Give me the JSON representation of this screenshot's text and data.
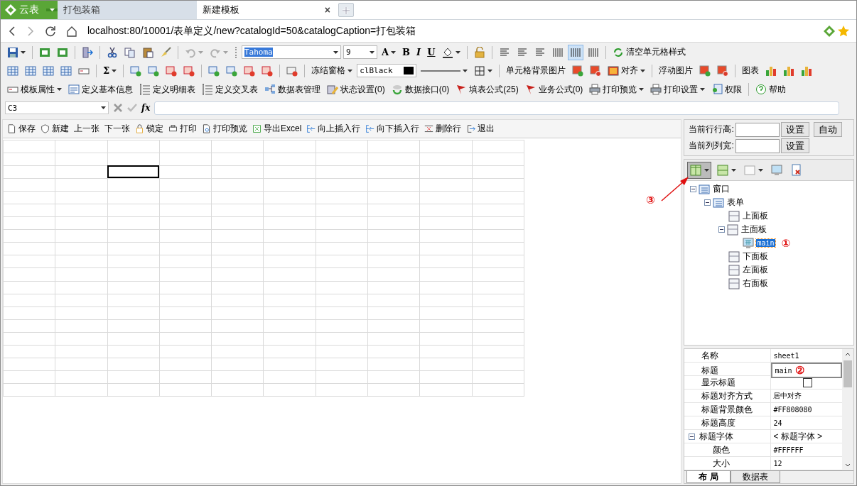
{
  "browser": {
    "brand": {
      "label": "云表",
      "dropdown": true
    },
    "tabs": [
      {
        "label": "打包装箱",
        "selected": false
      },
      {
        "label": "新建模板",
        "selected": true,
        "close": "×"
      }
    ],
    "address": "localhost:80/10001/表单定义/new?catalogId=50&catalogCaption=打包装箱"
  },
  "toolbars": [
    [
      {
        "kind": "icon",
        "dropdown": true
      },
      {
        "kind": "sep"
      },
      {
        "kind": "icon",
        "dropdown": false
      },
      {
        "kind": "icon",
        "dropdown": false
      },
      {
        "kind": "sep"
      },
      {
        "kind": "icon",
        "dropdown": false
      },
      {
        "kind": "sep"
      },
      {
        "kind": "icon",
        "dropdown": false
      },
      {
        "kind": "icon",
        "dropdown": false
      },
      {
        "kind": "icon",
        "dropdown": false
      },
      {
        "kind": "icon",
        "dropdown": false
      },
      {
        "kind": "sep"
      },
      {
        "kind": "icon",
        "dropdown": true,
        "disabled": true
      },
      {
        "kind": "icon",
        "dropdown": true,
        "disabled": true
      },
      {
        "kind": "grip"
      },
      {
        "kind": "combo",
        "value": "Tahoma",
        "highlighted": true,
        "wide": true
      },
      {
        "kind": "combo",
        "value": "9",
        "highlighted": false,
        "wide": false
      },
      {
        "kind": "glyph",
        "label": "A",
        "dropdown": true
      },
      {
        "kind": "glyph",
        "label": "B",
        "dropdown": false
      },
      {
        "kind": "glyph",
        "label": "I",
        "dropdown": false
      },
      {
        "kind": "glyph",
        "label": "U",
        "dropdown": false
      },
      {
        "kind": "icon",
        "dropdown": true
      },
      {
        "kind": "sep"
      },
      {
        "kind": "icon",
        "dropdown": false
      },
      {
        "kind": "sep"
      },
      {
        "kind": "icon",
        "dropdown": false
      },
      {
        "kind": "icon",
        "dropdown": false
      },
      {
        "kind": "icon",
        "dropdown": false
      },
      {
        "kind": "icon",
        "dropdown": false,
        "pressed": false
      },
      {
        "kind": "icon",
        "dropdown": false,
        "pressed": true
      },
      {
        "kind": "icon",
        "dropdown": false,
        "pressed": false
      },
      {
        "kind": "sep"
      },
      {
        "kind": "icon-text",
        "label": "清空单元格样式",
        "dropdown": false
      }
    ],
    [
      {
        "kind": "icon",
        "dropdown": false
      },
      {
        "kind": "icon",
        "dropdown": false
      },
      {
        "kind": "icon",
        "dropdown": false
      },
      {
        "kind": "icon",
        "dropdown": false
      },
      {
        "kind": "icon",
        "dropdown": false
      },
      {
        "kind": "sep"
      },
      {
        "kind": "glyph",
        "label": "Σ",
        "dropdown": true
      },
      {
        "kind": "sep"
      },
      {
        "kind": "icon",
        "dropdown": false
      },
      {
        "kind": "icon",
        "dropdown": false
      },
      {
        "kind": "icon",
        "dropdown": false
      },
      {
        "kind": "icon",
        "dropdown": false
      },
      {
        "kind": "sep"
      },
      {
        "kind": "icon",
        "dropdown": false
      },
      {
        "kind": "icon",
        "dropdown": false
      },
      {
        "kind": "icon",
        "dropdown": false
      },
      {
        "kind": "icon",
        "dropdown": false
      },
      {
        "kind": "sep"
      },
      {
        "kind": "icon",
        "dropdown": false
      },
      {
        "kind": "sep"
      },
      {
        "kind": "text",
        "label": "冻结窗格",
        "dropdown": true
      },
      {
        "kind": "color-combo",
        "value": "clBlack",
        "color": "#000000"
      },
      {
        "kind": "line",
        "dropdown": true
      },
      {
        "kind": "icon",
        "dropdown": true
      },
      {
        "kind": "sep"
      },
      {
        "kind": "text",
        "label": "单元格背景图片",
        "dropdown": false
      },
      {
        "kind": "icon",
        "dropdown": false
      },
      {
        "kind": "icon",
        "dropdown": false
      },
      {
        "kind": "icon-text",
        "label": "对齐",
        "dropdown": true
      },
      {
        "kind": "sep"
      },
      {
        "kind": "text",
        "label": "浮动图片",
        "dropdown": false
      },
      {
        "kind": "icon",
        "dropdown": false
      },
      {
        "kind": "icon",
        "dropdown": false
      },
      {
        "kind": "sep"
      },
      {
        "kind": "text",
        "label": "图表",
        "dropdown": false
      },
      {
        "kind": "icon",
        "dropdown": false
      },
      {
        "kind": "icon",
        "dropdown": false
      },
      {
        "kind": "icon",
        "dropdown": false
      }
    ],
    [
      {
        "kind": "icon-text",
        "label": "模板属性",
        "dropdown": true
      },
      {
        "kind": "icon-text",
        "label": "定义基本信息",
        "dropdown": false
      },
      {
        "kind": "icon-text",
        "label": "定义明细表",
        "dropdown": false
      },
      {
        "kind": "icon-text",
        "label": "定义交叉表",
        "dropdown": false
      },
      {
        "kind": "icon-text",
        "label": "数据表管理",
        "dropdown": false
      },
      {
        "kind": "icon-text",
        "label": "状态设置(0)",
        "dropdown": false
      },
      {
        "kind": "icon-text",
        "label": "数据接口(0)",
        "dropdown": false
      },
      {
        "kind": "icon-text",
        "label": "填表公式(25)",
        "dropdown": false
      },
      {
        "kind": "icon-text",
        "label": "业务公式(0)",
        "dropdown": false
      },
      {
        "kind": "icon-text",
        "label": "打印预览",
        "dropdown": true
      },
      {
        "kind": "icon-text",
        "label": "打印设置",
        "dropdown": true
      },
      {
        "kind": "icon-text",
        "label": "权限",
        "dropdown": false
      },
      {
        "kind": "sep"
      },
      {
        "kind": "icon-text",
        "label": "帮助",
        "dropdown": false
      }
    ]
  ],
  "formula_bar": {
    "name_box": "C3",
    "fx": "fx"
  },
  "actions": [
    "保存",
    "新建",
    "上一张",
    "下一张",
    "锁定",
    "打印",
    "打印预览",
    "导出Excel",
    "向上插入行",
    "向下插入行",
    "删除行",
    "退出"
  ],
  "sheet": {
    "rows": [
      [
        {
          "selected": false
        },
        {
          "selected": false
        },
        {
          "selected": false
        },
        {
          "selected": false
        },
        {
          "selected": false
        },
        {
          "selected": false
        },
        {
          "selected": false
        },
        {
          "selected": false
        },
        {
          "selected": false
        },
        {
          "selected": false
        }
      ],
      [
        {
          "selected": false
        },
        {
          "selected": false
        },
        {
          "selected": false
        },
        {
          "selected": false
        },
        {
          "selected": false
        },
        {
          "selected": false
        },
        {
          "selected": false
        },
        {
          "selected": false
        },
        {
          "selected": false
        },
        {
          "selected": false
        }
      ],
      [
        {
          "selected": false
        },
        {
          "selected": false
        },
        {
          "selected": true
        },
        {
          "selected": false
        },
        {
          "selected": false
        },
        {
          "selected": false
        },
        {
          "selected": false
        },
        {
          "selected": false
        },
        {
          "selected": false
        },
        {
          "selected": false
        }
      ],
      [
        {
          "selected": false
        },
        {
          "selected": false
        },
        {
          "selected": false
        },
        {
          "selected": false
        },
        {
          "selected": false
        },
        {
          "selected": false
        },
        {
          "selected": false
        },
        {
          "selected": false
        },
        {
          "selected": false
        },
        {
          "selected": false
        }
      ],
      [
        {
          "selected": false
        },
        {
          "selected": false
        },
        {
          "selected": false
        },
        {
          "selected": false
        },
        {
          "selected": false
        },
        {
          "selected": false
        },
        {
          "selected": false
        },
        {
          "selected": false
        },
        {
          "selected": false
        },
        {
          "selected": false
        }
      ],
      [
        {
          "selected": false
        },
        {
          "selected": false
        },
        {
          "selected": false
        },
        {
          "selected": false
        },
        {
          "selected": false
        },
        {
          "selected": false
        },
        {
          "selected": false
        },
        {
          "selected": false
        },
        {
          "selected": false
        },
        {
          "selected": false
        }
      ],
      [
        {
          "selected": false
        },
        {
          "selected": false
        },
        {
          "selected": false
        },
        {
          "selected": false
        },
        {
          "selected": false
        },
        {
          "selected": false
        },
        {
          "selected": false
        },
        {
          "selected": false
        },
        {
          "selected": false
        },
        {
          "selected": false
        }
      ],
      [
        {
          "selected": false
        },
        {
          "selected": false
        },
        {
          "selected": false
        },
        {
          "selected": false
        },
        {
          "selected": false
        },
        {
          "selected": false
        },
        {
          "selected": false
        },
        {
          "selected": false
        },
        {
          "selected": false
        },
        {
          "selected": false
        }
      ],
      [
        {
          "selected": false
        },
        {
          "selected": false
        },
        {
          "selected": false
        },
        {
          "selected": false
        },
        {
          "selected": false
        },
        {
          "selected": false
        },
        {
          "selected": false
        },
        {
          "selected": false
        },
        {
          "selected": false
        },
        {
          "selected": false
        }
      ],
      [
        {
          "selected": false
        },
        {
          "selected": false
        },
        {
          "selected": false
        },
        {
          "selected": false
        },
        {
          "selected": false
        },
        {
          "selected": false
        },
        {
          "selected": false
        },
        {
          "selected": false
        },
        {
          "selected": false
        },
        {
          "selected": false
        }
      ],
      [
        {
          "selected": false
        },
        {
          "selected": false
        },
        {
          "selected": false
        },
        {
          "selected": false
        },
        {
          "selected": false
        },
        {
          "selected": false
        },
        {
          "selected": false
        },
        {
          "selected": false
        },
        {
          "selected": false
        },
        {
          "selected": false
        }
      ],
      [
        {
          "selected": false
        },
        {
          "selected": false
        },
        {
          "selected": false
        },
        {
          "selected": false
        },
        {
          "selected": false
        },
        {
          "selected": false
        },
        {
          "selected": false
        },
        {
          "selected": false
        },
        {
          "selected": false
        },
        {
          "selected": false
        }
      ],
      [
        {
          "selected": false
        },
        {
          "selected": false
        },
        {
          "selected": false
        },
        {
          "selected": false
        },
        {
          "selected": false
        },
        {
          "selected": false
        },
        {
          "selected": false
        },
        {
          "selected": false
        },
        {
          "selected": false
        },
        {
          "selected": false
        }
      ],
      [
        {
          "selected": false
        },
        {
          "selected": false
        },
        {
          "selected": false
        },
        {
          "selected": false
        },
        {
          "selected": false
        },
        {
          "selected": false
        },
        {
          "selected": false
        },
        {
          "selected": false
        },
        {
          "selected": false
        },
        {
          "selected": false
        }
      ],
      [
        {
          "selected": false
        },
        {
          "selected": false
        },
        {
          "selected": false
        },
        {
          "selected": false
        },
        {
          "selected": false
        },
        {
          "selected": false
        },
        {
          "selected": false
        },
        {
          "selected": false
        },
        {
          "selected": false
        },
        {
          "selected": false
        }
      ],
      [
        {
          "selected": false
        },
        {
          "selected": false
        },
        {
          "selected": false
        },
        {
          "selected": false
        },
        {
          "selected": false
        },
        {
          "selected": false
        },
        {
          "selected": false
        },
        {
          "selected": false
        },
        {
          "selected": false
        },
        {
          "selected": false
        }
      ],
      [
        {
          "selected": false
        },
        {
          "selected": false
        },
        {
          "selected": false
        },
        {
          "selected": false
        },
        {
          "selected": false
        },
        {
          "selected": false
        },
        {
          "selected": false
        },
        {
          "selected": false
        },
        {
          "selected": false
        },
        {
          "selected": false
        }
      ],
      [
        {
          "selected": false
        },
        {
          "selected": false
        },
        {
          "selected": false
        },
        {
          "selected": false
        },
        {
          "selected": false
        },
        {
          "selected": false
        },
        {
          "selected": false
        },
        {
          "selected": false
        },
        {
          "selected": false
        },
        {
          "selected": false
        }
      ],
      [
        {
          "selected": false
        },
        {
          "selected": false
        },
        {
          "selected": false
        },
        {
          "selected": false
        },
        {
          "selected": false
        },
        {
          "selected": false
        },
        {
          "selected": false
        },
        {
          "selected": false
        },
        {
          "selected": false
        },
        {
          "selected": false
        }
      ],
      [
        {
          "selected": false
        },
        {
          "selected": false
        },
        {
          "selected": false
        },
        {
          "selected": false
        },
        {
          "selected": false
        },
        {
          "selected": false
        },
        {
          "selected": false
        },
        {
          "selected": false
        },
        {
          "selected": false
        },
        {
          "selected": false
        }
      ]
    ]
  },
  "size_panel": {
    "row_height_label": "当前行行高:",
    "col_width_label": "当前列列宽:",
    "set_row": "设置",
    "auto": "自动",
    "set_col": "设置"
  },
  "tree_toolbar": [
    {
      "pressed": true,
      "dropdown": true
    },
    {
      "pressed": false,
      "dropdown": true
    },
    {
      "pressed": false,
      "dropdown": true
    },
    {
      "pressed": false,
      "dropdown": false
    },
    {
      "pressed": false,
      "dropdown": false
    }
  ],
  "tree": [
    {
      "label": "窗口",
      "expanded": true,
      "selected": false,
      "children": [
        {
          "label": "表单",
          "expanded": true,
          "selected": false,
          "children": [
            {
              "label": "上面板",
              "selected": false
            },
            {
              "label": "主面板",
              "expanded": true,
              "selected": false,
              "children": [
                {
                  "label": "main",
                  "selected": true,
                  "annotation": "①"
                }
              ]
            },
            {
              "label": "下面板",
              "selected": false
            },
            {
              "label": "左面板",
              "selected": false
            },
            {
              "label": "右面板",
              "selected": false
            }
          ]
        }
      ]
    }
  ],
  "arrow_annotation": "③",
  "properties": [
    {
      "kind": "text",
      "name": "名称",
      "value": "sheet1"
    },
    {
      "kind": "edit",
      "name": "标题",
      "value": "main",
      "annotation": "②"
    },
    {
      "kind": "checkbox",
      "name": "显示标题",
      "checked": false
    },
    {
      "kind": "text",
      "name": "标题对齐方式",
      "value": "居中对齐"
    },
    {
      "kind": "text",
      "name": "标题背景颜色",
      "value": "#FF808080"
    },
    {
      "kind": "text",
      "name": "标题高度",
      "value": "24"
    },
    {
      "kind": "group",
      "name": "标题字体",
      "value": "< 标题字体 >",
      "expanded": true
    },
    {
      "kind": "sub",
      "name": "颜色",
      "value": "#FFFFFF"
    },
    {
      "kind": "sub",
      "name": "大小",
      "value": "12"
    }
  ],
  "bottom_tabs": [
    {
      "label": "布 局",
      "selected": true
    },
    {
      "label": "数据表",
      "selected": false
    }
  ]
}
